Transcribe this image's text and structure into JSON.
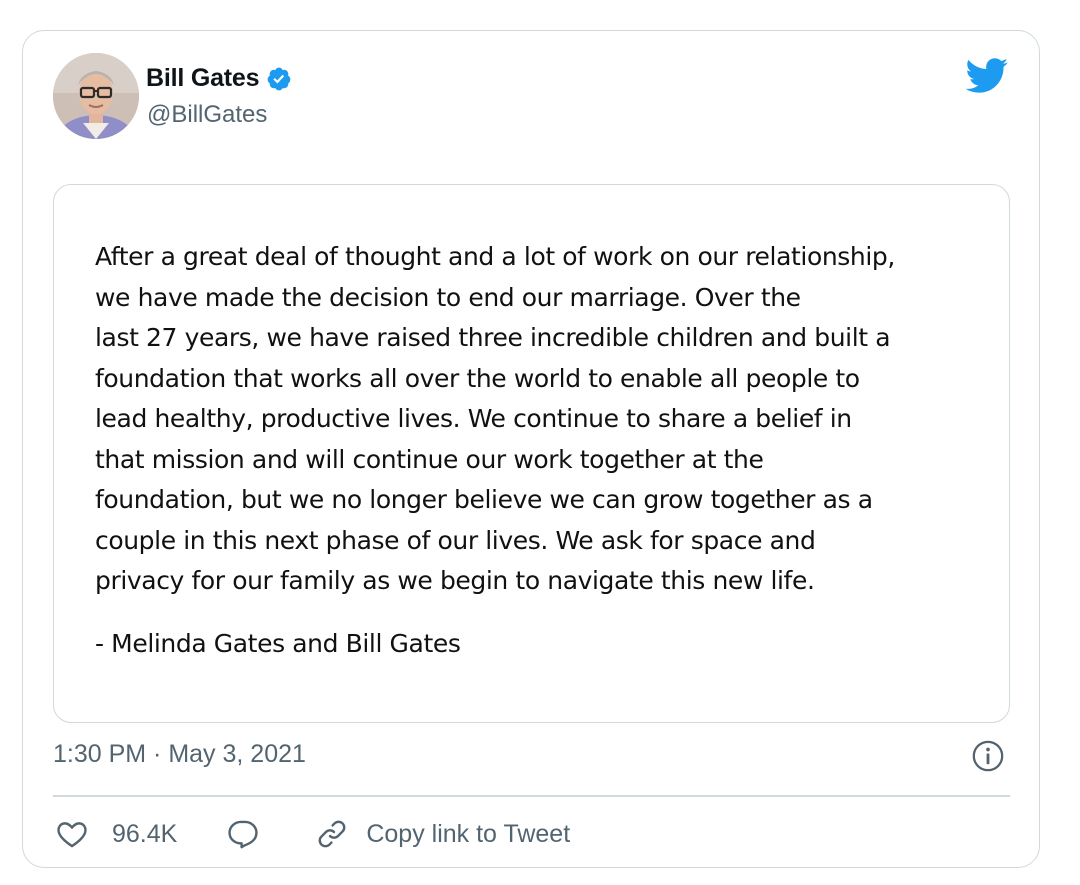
{
  "author": {
    "display_name": "Bill Gates",
    "handle": "@BillGates",
    "verified": true
  },
  "quote": {
    "lines": [
      "After a great deal of thought and a lot of work on our relationship,",
      "we have made the decision to end our marriage. Over the",
      "last 27 years, we have raised three incredible children and built a",
      "foundation that works all over the world to enable all people to",
      "lead healthy, productive lives. We continue to share a belief in",
      "that mission and will continue our work together at the",
      "foundation, but we no longer believe we can grow together as a",
      "couple in this next phase of our lives. We ask for space and",
      "privacy for our family as we begin to navigate this new life."
    ],
    "signature": "- Melinda Gates and Bill Gates"
  },
  "timestamp": "1:30 PM · May 3, 2021",
  "actions": {
    "like_count": "96.4K",
    "copy_link_label": "Copy link to Tweet"
  },
  "icons": {
    "twitter": "twitter-bird-icon",
    "verified": "verified-badge-icon",
    "info": "info-icon",
    "like": "heart-icon",
    "reply": "reply-bubble-icon",
    "link": "link-icon"
  },
  "colors": {
    "accent": "#1d9bf0",
    "text_primary": "#0f1419",
    "text_secondary": "#536471",
    "border": "#cfd9de"
  }
}
